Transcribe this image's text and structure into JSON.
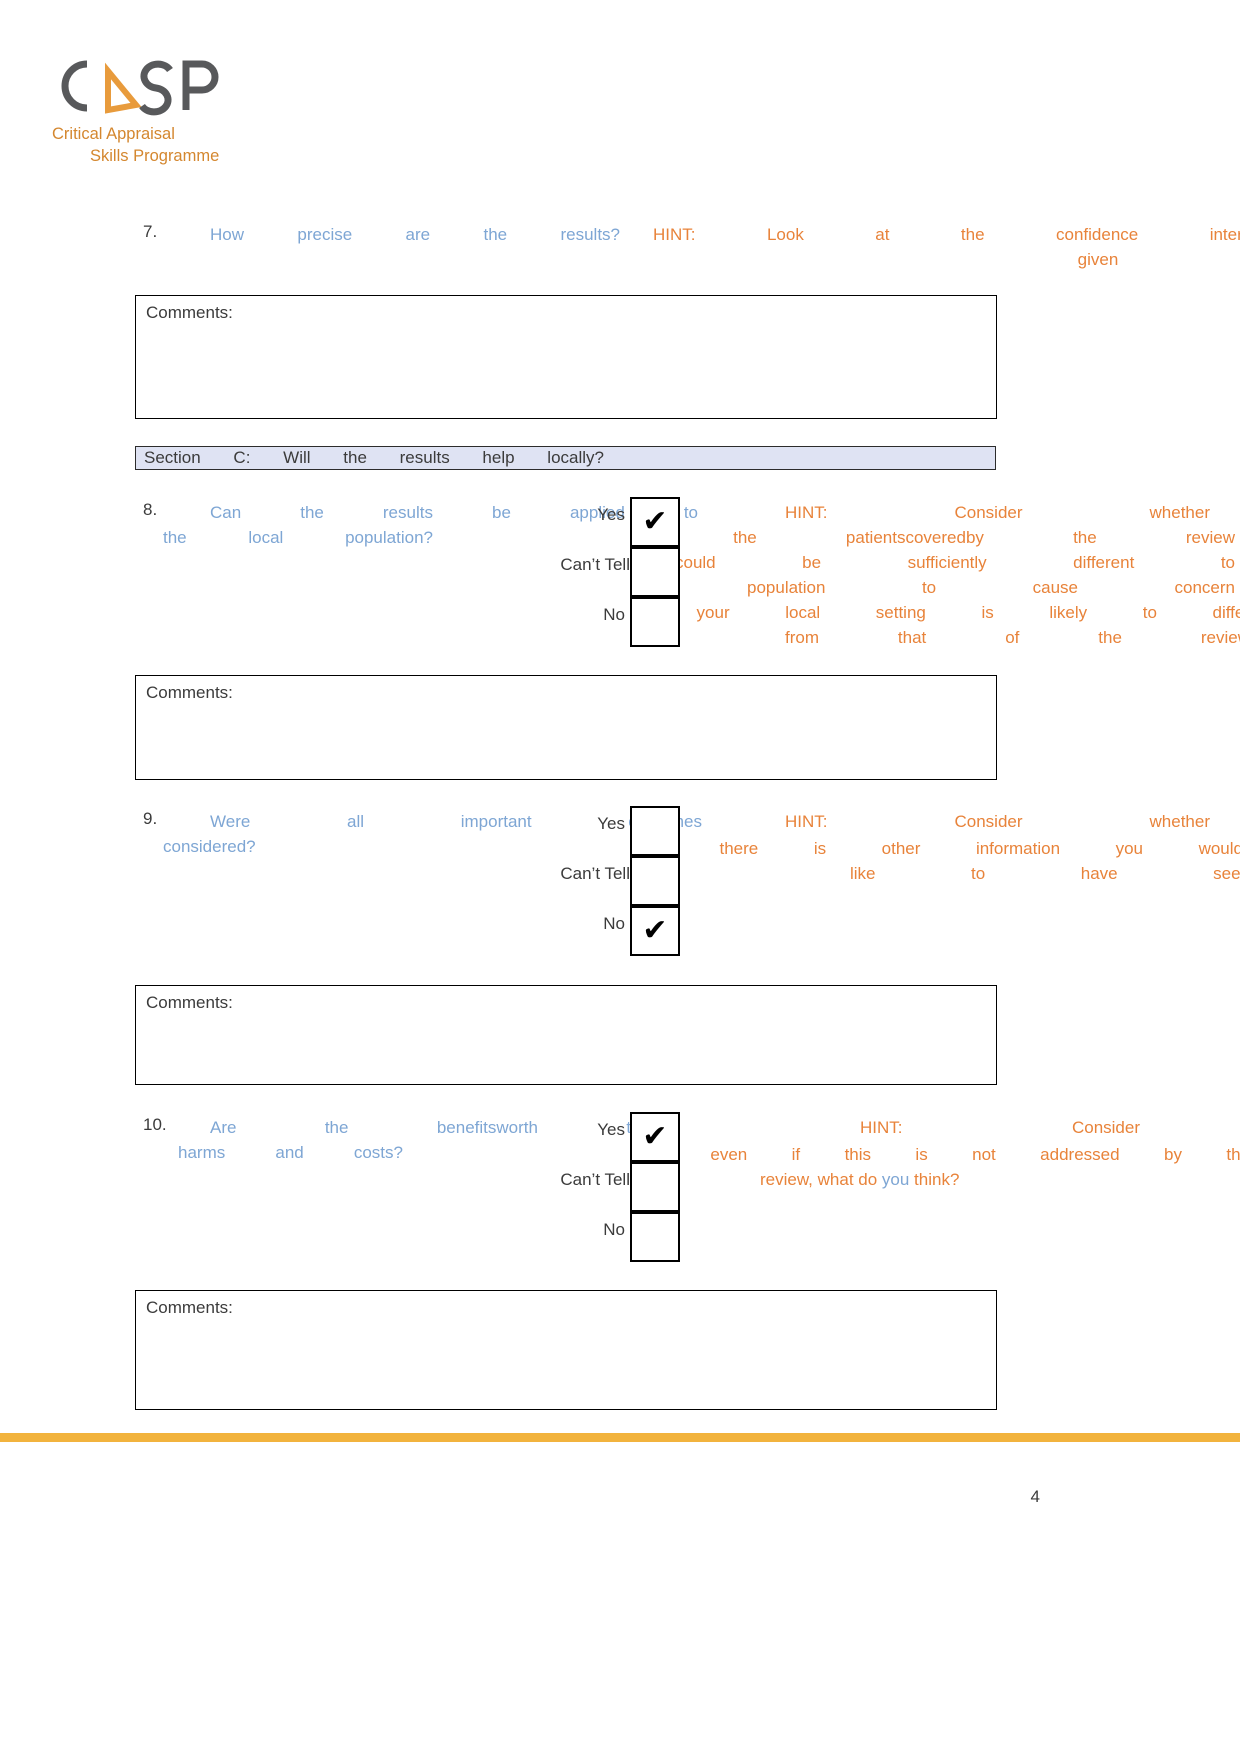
{
  "logo": {
    "brand": "CASP",
    "tagline_line1": "Critical Appraisal",
    "tagline_line2": "Skills Programme",
    "brand_gray": "#58595B",
    "brand_orange": "#E89B3C"
  },
  "colors": {
    "question_blue": "#7EA6D4",
    "hint_orange": "#E8833A",
    "section_bar_bg": "#DFE3F3",
    "footer_bar": "#F2B33D",
    "body_text": "#3B3B3B"
  },
  "comments_label": "Comments:",
  "section": {
    "bar_text": "Section C:  Will  the  results  help  locally?"
  },
  "questions": [
    {
      "number": "7.",
      "text_line1": "How  precise  are  the  results?",
      "hint_line1": "HINT:  Look  at  the  confidence  intervals",
      "hint_line2": "given",
      "has_answers": false
    },
    {
      "number": "8.",
      "text_line1": "Can  the  results  be  applied to",
      "text_line2": "the  local  population?",
      "hint_line1": "HINT:  Consider  whether",
      "hint_line2": "•   the   patientscoveredby   the   review",
      "hint_line3": "could  be  sufficiently  different  to",
      "hint_line4": "population  to  cause  concern",
      "hint_line5": "•  your  local  setting  is  likely  to  differ",
      "hint_line6": "from  that  of  the  review",
      "has_answers": true,
      "answers": [
        {
          "label": "Yes",
          "checked": true
        },
        {
          "label": "Can’t Tell",
          "checked": false
        },
        {
          "label": "No",
          "checked": false
        }
      ]
    },
    {
      "number": "9.",
      "text_line1": "Were  all  important  outcomes",
      "text_line2": "considered?",
      "hint_line1": "HINT:  Consider  whether",
      "hint_line2": "•  there  is  other  information  you  would",
      "hint_line3": "like  to  have  seen",
      "has_answers": true,
      "answers": [
        {
          "label": "Yes",
          "checked": false
        },
        {
          "label": "Can’t Tell",
          "checked": false
        },
        {
          "label": "No",
          "checked": true
        }
      ]
    },
    {
      "number": "10.",
      "text_line1": "Are  the  benefitsworth  the",
      "text_line2": "harms  and  costs?",
      "hint_line1": "HINT:  Consider",
      "hint_line2": "•   even   if   this   is   not   addressed by the",
      "hint_line3_a": "review, what  do ",
      "hint_line3_you": "you",
      "hint_line3_b": "  think?",
      "has_answers": true,
      "answers": [
        {
          "label": "Yes",
          "checked": true
        },
        {
          "label": "Can’t Tell",
          "checked": false
        },
        {
          "label": "No",
          "checked": false
        }
      ]
    }
  ],
  "tick_glyph": "✔",
  "footer": {
    "page_number": "4"
  }
}
